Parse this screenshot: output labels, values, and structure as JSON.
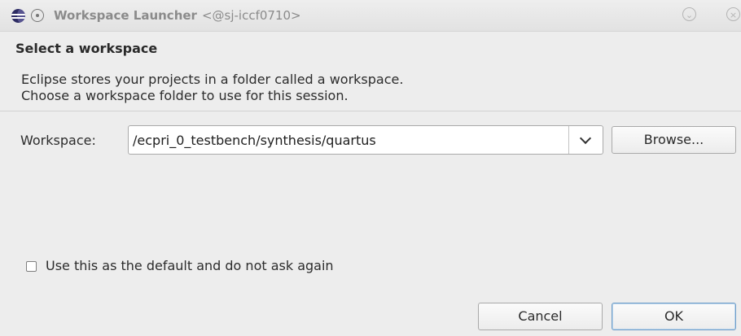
{
  "window": {
    "title": "Workspace Launcher",
    "host": "<@sj-iccf0710>",
    "icons": {
      "app": "eclipse-logo-icon",
      "menu": "window-menu-icon",
      "minimize": "minimize-icon",
      "close": "close-icon"
    }
  },
  "dialog": {
    "heading": "Select a workspace",
    "description": [
      "Eclipse stores your projects in a folder called a workspace.",
      "Choose a workspace folder to use for this session."
    ]
  },
  "workspace": {
    "label": "Workspace:",
    "value": "/ecpri_0_testbench/synthesis/quartus",
    "browse_label": "Browse..."
  },
  "options": {
    "default_checkbox_label": "Use this as the default and do not ask again",
    "default_checked": false
  },
  "buttons": {
    "cancel": "Cancel",
    "ok": "OK"
  },
  "colors": {
    "ok_border": "#6f9ec8",
    "background": "#ededed"
  }
}
